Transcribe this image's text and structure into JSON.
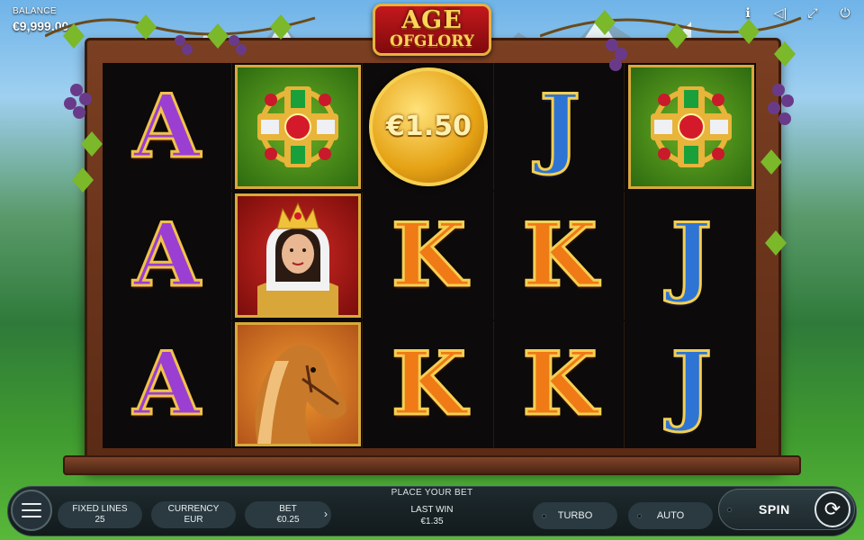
{
  "hud": {
    "balance_label": "BALANCE",
    "balance_value": "€9,999.00",
    "icons": [
      "info-icon",
      "sound-icon",
      "fullscreen-icon",
      "power-icon"
    ]
  },
  "logo": {
    "line1": "AGE",
    "line2": "OFGLORY"
  },
  "reels": [
    [
      "A",
      "cross-jewel",
      "coin"
    ],
    [
      "A",
      "queen",
      "K"
    ],
    [
      "A",
      "horse",
      "K"
    ]
  ],
  "symbols": {
    "coin_value": "€1.50"
  },
  "bottom_bar": {
    "place_bet": "PLACE YOUR BET",
    "fixed_lines_label": "FIXED LINES",
    "fixed_lines_value": "25",
    "currency_label": "CURRENCY",
    "currency_value": "EUR",
    "bet_label": "BET",
    "bet_value": "€0.25",
    "bet_arrow": "›",
    "last_win_label": "LAST WIN",
    "last_win_value": "€1.35",
    "turbo_label": "TURBO",
    "auto_label": "AUTO",
    "spin_label": "SPIN"
  },
  "colors": {
    "a_symbol": "#9a3fd2",
    "k_symbol": "#ef7a16",
    "j_symbol": "#2d74d4",
    "gold_trim": "#d9a93a"
  }
}
